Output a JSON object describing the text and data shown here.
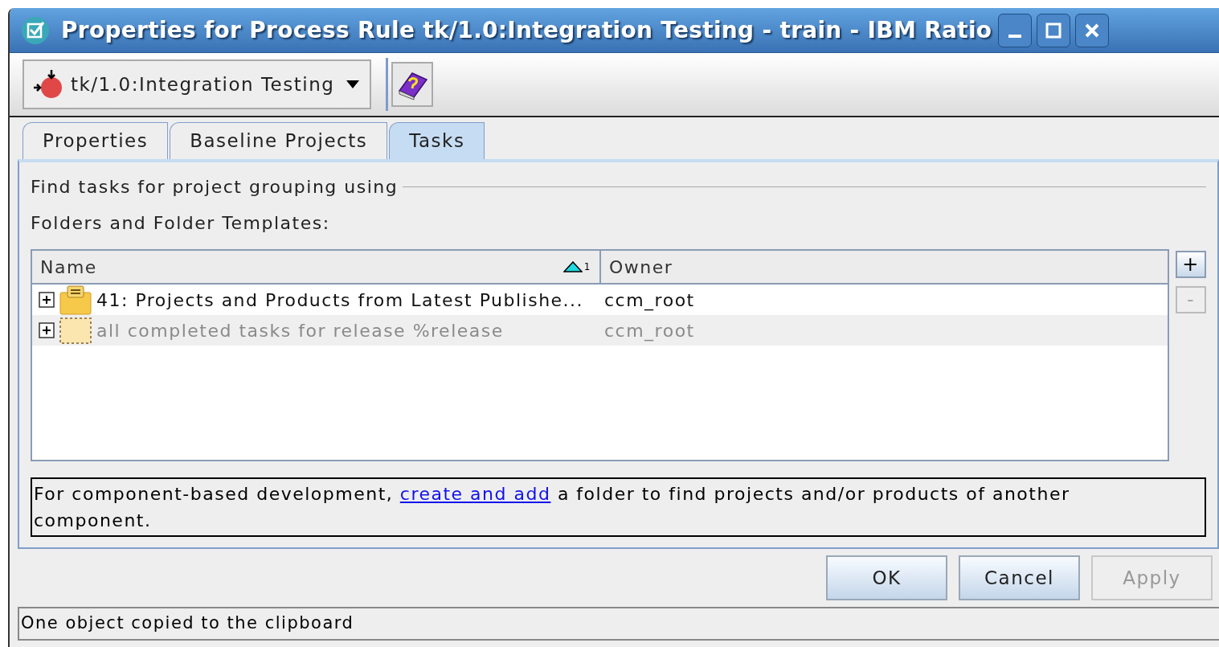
{
  "window": {
    "title": "Properties for Process Rule tk/1.0:Integration Testing - train - IBM Ratio"
  },
  "toolbar": {
    "selector": "tk/1.0:Integration Testing"
  },
  "tabs": [
    {
      "label": "Properties",
      "selected": false
    },
    {
      "label": "Baseline Projects",
      "selected": false
    },
    {
      "label": "Tasks",
      "selected": true
    }
  ],
  "group_title": "Find tasks for project grouping using",
  "list_label": "Folders and Folder Templates:",
  "table": {
    "columns": [
      {
        "label": "Name",
        "sort_mark": "1"
      },
      {
        "label": "Owner"
      }
    ],
    "rows": [
      {
        "kind": "folder",
        "name": "41: Projects and Products from Latest Publishe...",
        "owner": "ccm_root",
        "expanded": false,
        "disabled": false
      },
      {
        "kind": "template",
        "name": "all completed tasks for release %release",
        "owner": "ccm_root",
        "expanded": false,
        "disabled": true
      }
    ]
  },
  "side_buttons": [
    {
      "label": "+",
      "disabled": false
    },
    {
      "label": "-",
      "disabled": true
    }
  ],
  "note": {
    "before": "For component-based development, ",
    "link": "create and add",
    "after": " a folder to find projects and/or products of another component."
  },
  "buttons": [
    {
      "label": "OK",
      "disabled": false
    },
    {
      "label": "Cancel",
      "disabled": false
    },
    {
      "label": "Apply",
      "disabled": true
    }
  ],
  "status_bar": "One object copied to the clipboard"
}
